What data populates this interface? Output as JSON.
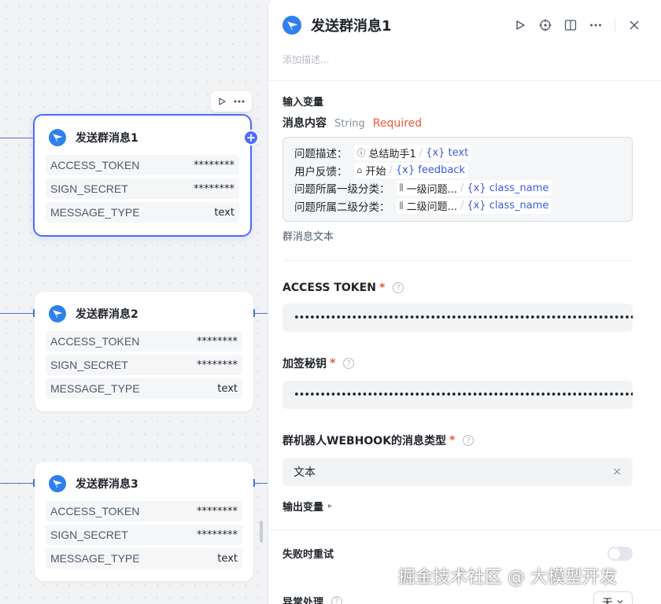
{
  "nodes": [
    {
      "title": "发送群消息1",
      "rows": [
        {
          "key": "ACCESS_TOKEN",
          "value": "********"
        },
        {
          "key": "SIGN_SECRET",
          "value": "********"
        },
        {
          "key": "MESSAGE_TYPE",
          "value": "text"
        }
      ]
    },
    {
      "title": "发送群消息2",
      "rows": [
        {
          "key": "ACCESS_TOKEN",
          "value": "********"
        },
        {
          "key": "SIGN_SECRET",
          "value": "********"
        },
        {
          "key": "MESSAGE_TYPE",
          "value": "text"
        }
      ]
    },
    {
      "title": "发送群消息3",
      "rows": [
        {
          "key": "ACCESS_TOKEN",
          "value": "********"
        },
        {
          "key": "SIGN_SECRET",
          "value": "********"
        },
        {
          "key": "MESSAGE_TYPE",
          "value": "text"
        }
      ]
    }
  ],
  "panel": {
    "title": "发送群消息1",
    "description_placeholder": "添加描述...",
    "input_section": "输入变量",
    "variable": {
      "name": "消息内容",
      "type": "String",
      "required": "Required"
    },
    "editor_lines": [
      {
        "label": "问题描述：",
        "chip_icon": "ⓘ",
        "chip_node": "总结助手1",
        "chip_var": "{x} text"
      },
      {
        "label": "用户反馈：",
        "chip_icon": "⌂",
        "chip_node": "开始",
        "chip_var": "{x} feedback"
      },
      {
        "label": "问题所属一级分类：",
        "chip_icon": "⫼",
        "chip_node": "一级问题...",
        "chip_var": "{x} class_name"
      },
      {
        "label": "问题所属二级分类：",
        "chip_icon": "⫼",
        "chip_node": "二级问题...",
        "chip_var": "{x} class_name"
      }
    ],
    "editor_hint": "群消息文本",
    "access_token": {
      "label": "ACCESS TOKEN",
      "required_mark": "*",
      "value": "••••••••••••••••••••••••••••••••••••••••••••••••••••••••••••••••••••••"
    },
    "sign_secret": {
      "label": "加签秘钥",
      "required_mark": "*",
      "value": "••••••••••••••••••••••••••••••••••••••••••••••••••••••••••••••••••••••"
    },
    "message_type": {
      "label": "群机器人WEBHOOK的消息类型",
      "required_mark": "*",
      "value": "文本",
      "clear": "×"
    },
    "output_section": "输出变量",
    "output_caret": "▸",
    "retry_label": "失败时重试",
    "exception_label": "异常处理",
    "exception_select": "无"
  },
  "watermark": "掘金技术社区 @ 大模型开发",
  "colors": {
    "accent": "#4d6bfe",
    "required": "#e8573a",
    "variable": "#3b5bdb",
    "node_icon": "#2f80ed"
  }
}
